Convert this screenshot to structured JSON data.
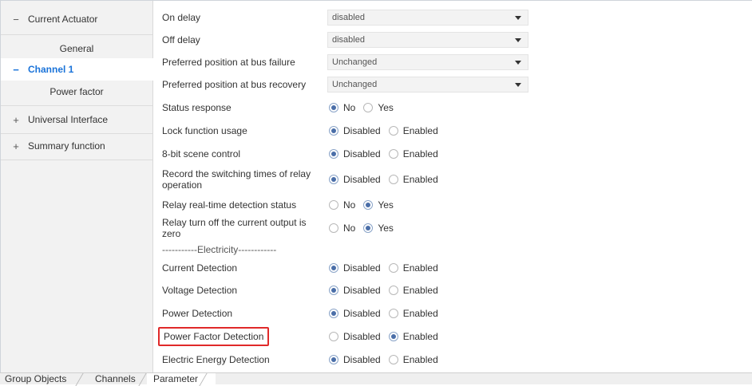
{
  "sidebar": {
    "items": [
      {
        "toggle": "−",
        "label": "Current Actuator"
      },
      {
        "toggle": "",
        "label": "General"
      },
      {
        "toggle": "−",
        "label": "Channel 1"
      },
      {
        "toggle": "",
        "label": "Power factor"
      },
      {
        "toggle": "+",
        "label": "Universal Interface"
      },
      {
        "toggle": "+",
        "label": "Summary function"
      }
    ],
    "selected": "Channel 1"
  },
  "params": {
    "on_delay": {
      "label": "On delay",
      "value": "disabled"
    },
    "off_delay": {
      "label": "Off delay",
      "value": "disabled"
    },
    "bus_failure": {
      "label": "Preferred position at bus failure",
      "value": "Unchanged"
    },
    "bus_recovery": {
      "label": "Preferred position at bus recovery",
      "value": "Unchanged"
    },
    "status_response": {
      "label": "Status response",
      "opt1": "No",
      "opt2": "Yes",
      "selected": "No"
    },
    "lock_function": {
      "label": "Lock function usage",
      "opt1": "Disabled",
      "opt2": "Enabled",
      "selected": "Disabled"
    },
    "scene_control": {
      "label": "8-bit scene control",
      "opt1": "Disabled",
      "opt2": "Enabled",
      "selected": "Disabled"
    },
    "record_switching": {
      "label": "Record the switching times of relay operation",
      "opt1": "Disabled",
      "opt2": "Enabled",
      "selected": "Disabled"
    },
    "relay_detection": {
      "label": "Relay real-time detection status",
      "opt1": "No",
      "opt2": "Yes",
      "selected": "Yes"
    },
    "relay_turn_off": {
      "label": "Relay turn off the current output is zero",
      "opt1": "No",
      "opt2": "Yes",
      "selected": "Yes"
    },
    "section_electricity": "-----------Electricity------------",
    "current_detection": {
      "label": "Current Detection",
      "opt1": "Disabled",
      "opt2": "Enabled",
      "selected": "Disabled"
    },
    "voltage_detection": {
      "label": "Voltage Detection",
      "opt1": "Disabled",
      "opt2": "Enabled",
      "selected": "Disabled"
    },
    "power_detection": {
      "label": "Power Detection",
      "opt1": "Disabled",
      "opt2": "Enabled",
      "selected": "Disabled"
    },
    "power_factor_detection": {
      "label": "Power Factor Detection",
      "opt1": "Disabled",
      "opt2": "Enabled",
      "selected": "Enabled"
    },
    "energy_detection": {
      "label": "Electric Energy Detection",
      "opt1": "Disabled",
      "opt2": "Enabled",
      "selected": "Disabled"
    }
  },
  "tabs": {
    "group_objects": "Group Objects",
    "channels": "Channels",
    "parameter": "Parameter",
    "active": "Parameter"
  },
  "colors": {
    "highlight_border": "#e02a2a",
    "selected_text": "#1a73d9",
    "radio_selected": "#4a6ea8"
  }
}
